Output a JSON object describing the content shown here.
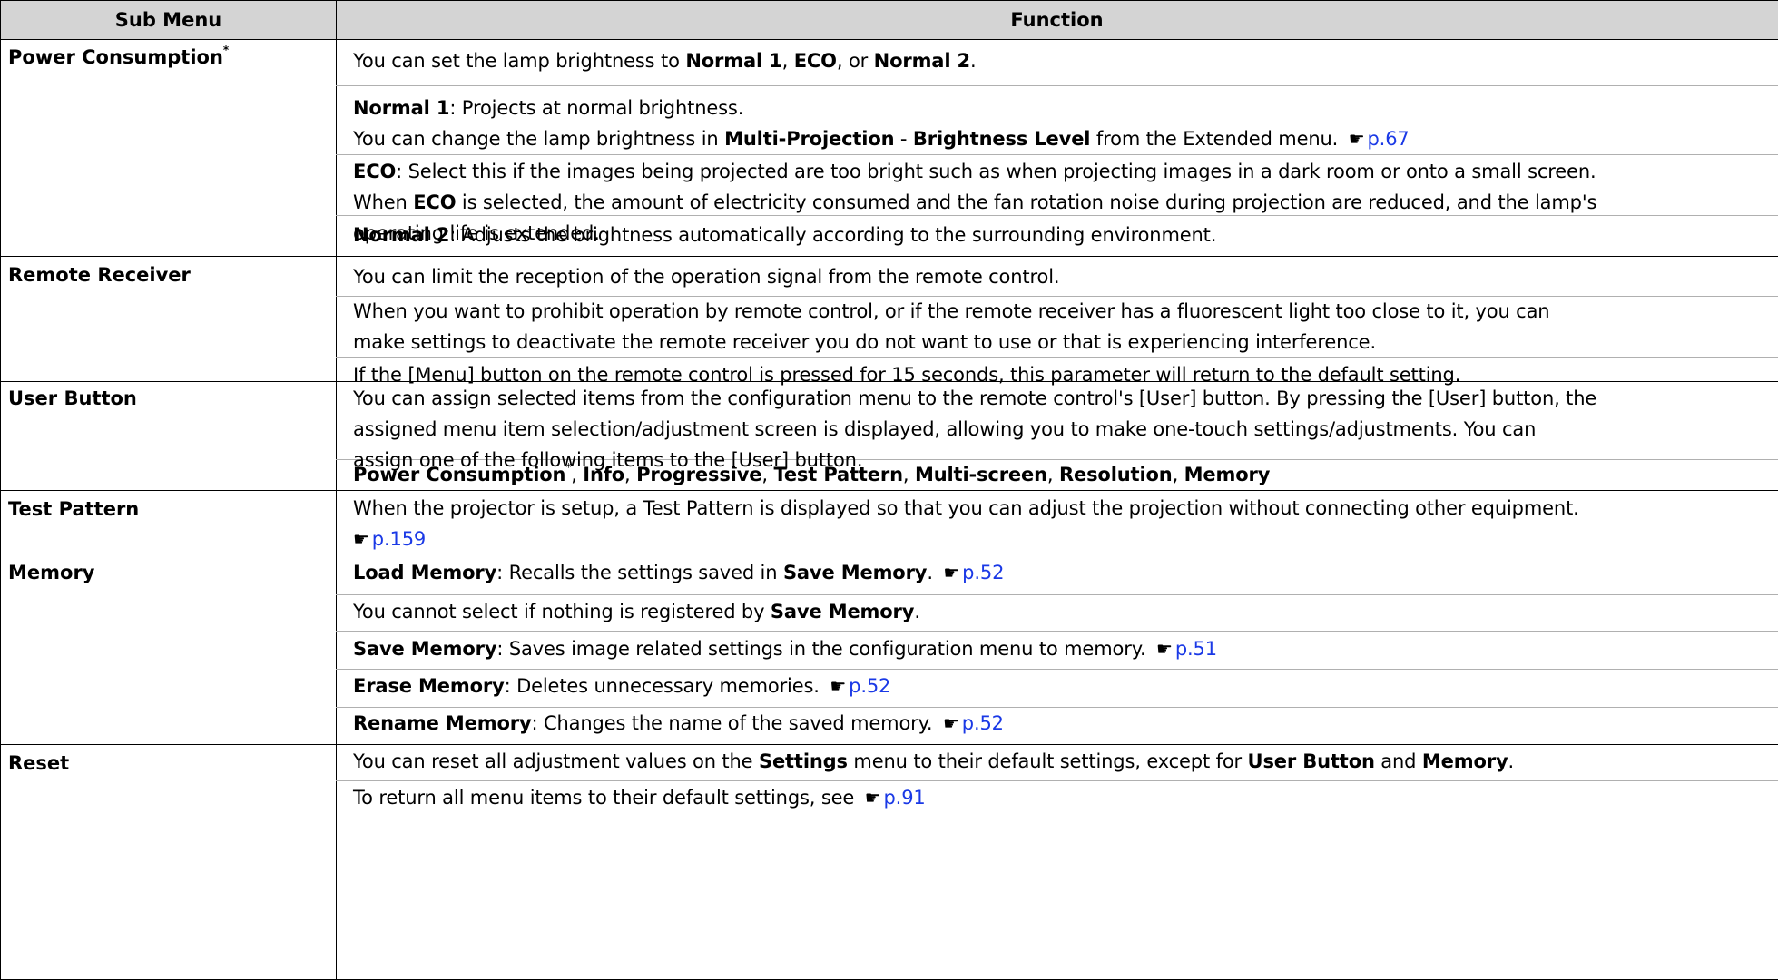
{
  "header": {
    "sub_menu": "Sub Menu",
    "function": "Function"
  },
  "rows": [
    {
      "name": "Power Consumption",
      "star": "*",
      "p1": {
        "a": "You can set the lamp brightness to ",
        "b1": "Normal 1",
        "c": ", ",
        "b2": "ECO",
        "d": ", or ",
        "b3": "Normal 2",
        "e": "."
      },
      "p2": {
        "b": "Normal 1",
        "t": ": Projects at normal brightness.",
        "l2a": "You can change the lamp brightness in ",
        "l2b1": "Multi-Projection",
        "l2c": " - ",
        "l2b2": "Brightness Level",
        "l2d": " from the Extended menu. ",
        "link": "p.67"
      },
      "p3": {
        "b": "ECO",
        "t": ": Select this if the images being projected are too bright such as when projecting images in a dark room or onto a small screen.",
        "l2a": "When ",
        "l2b": "ECO",
        "l2c": " is selected, the amount of electricity consumed and the fan rotation noise during projection are reduced, and the lamp's",
        "l3": "operating life is extended."
      },
      "p4": {
        "b": "Normal 2",
        "t": ": Adjusts the brightness automatically according to the surrounding environment."
      }
    },
    {
      "name": "Remote Receiver",
      "p1": "You can limit the reception of the operation signal from the remote control.",
      "p2a": "When you want to prohibit operation by remote control, or if the remote receiver has a fluorescent light too close to it, you can",
      "p2b": "make settings to deactivate the remote receiver you do not want to use or that is experiencing interference.",
      "p3": "If the [Menu] button on the remote control is pressed for 15 seconds, this parameter will return to the default setting."
    },
    {
      "name": "User Button",
      "p1a": "You can assign selected items from the configuration menu to the remote control's [User] button. By pressing the [User] button, the",
      "p1b": "assigned menu item selection/adjustment screen is displayed, allowing you to make one-touch settings/adjustments. You can",
      "p1c": "assign one of the following items to the [User] button.",
      "items": [
        "Power Consumption",
        "*",
        ", ",
        "Info",
        ", ",
        "Progressive",
        ", ",
        "Test Pattern",
        ", ",
        "Multi-screen",
        ", ",
        "Resolution",
        ", ",
        "Memory"
      ]
    },
    {
      "name": "Test Pattern",
      "p1": "When the projector is setup, a Test Pattern is displayed so that you can adjust the projection without connecting other equipment.",
      "link": "p.159"
    },
    {
      "name": "Memory",
      "p1": {
        "b": "Load Memory",
        "t": ": Recalls the settings saved in ",
        "b2": "Save Memory",
        "t2": ". ",
        "link": "p.52"
      },
      "p2": {
        "t": "You cannot select if nothing is registered by ",
        "b": "Save Memory",
        "t2": "."
      },
      "p3": {
        "b": "Save Memory",
        "t": ": Saves image related settings in the configuration menu to memory. ",
        "link": "p.51"
      },
      "p4": {
        "b": "Erase Memory",
        "t": ": Deletes unnecessary memories. ",
        "link": "p.52"
      },
      "p5": {
        "b": "Rename Memory",
        "t": ": Changes the name of the saved memory. ",
        "link": "p.52"
      }
    },
    {
      "name": "Reset",
      "p1": {
        "a": "You can reset all adjustment values on the ",
        "b1": "Settings",
        "c": " menu to their default settings, except for ",
        "b2": "User Button",
        "d": " and ",
        "b3": "Memory",
        "e": "."
      },
      "p2": {
        "t": "To return all menu items to their default settings, see ",
        "link": "p.91"
      }
    }
  ],
  "icons": {
    "reference": "pointing-hand-icon"
  },
  "colors": {
    "header_bg": "#d4d4d4",
    "link": "#1a39e6",
    "border": "#000000",
    "separator": "#b0b0b0"
  }
}
